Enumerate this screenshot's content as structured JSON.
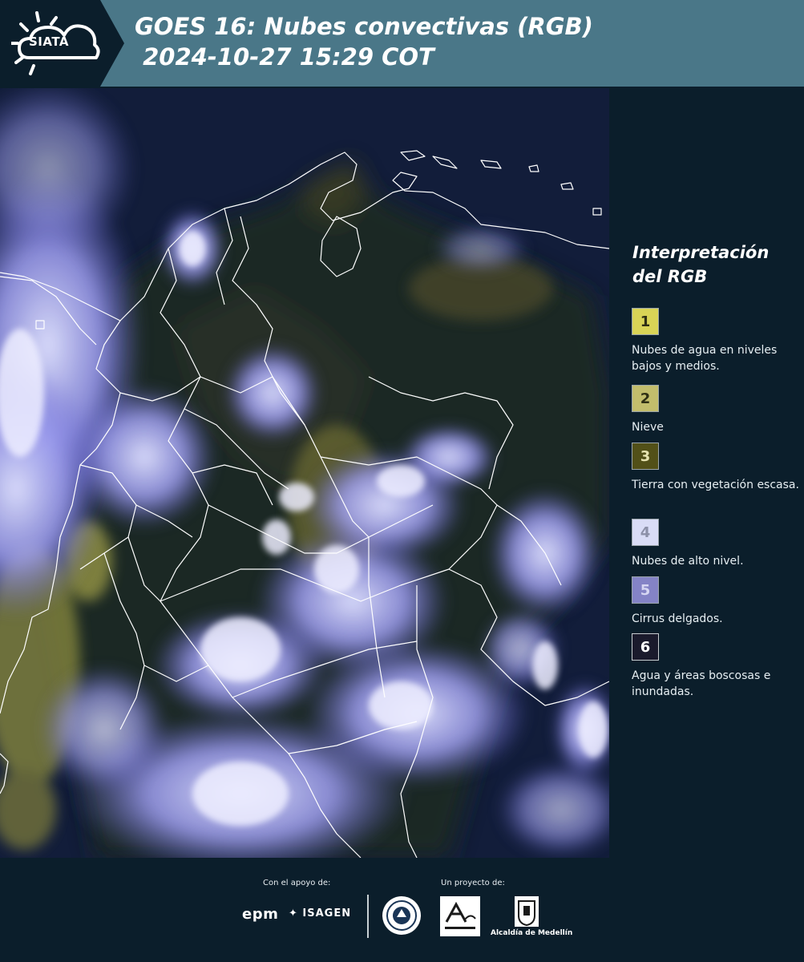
{
  "header": {
    "logo_text": "SIATA",
    "title_line1": "GOES 16: Nubes convectivas (RGB)",
    "title_line2": " 2024-10-27 15:29 COT"
  },
  "legend": {
    "title": "Interpretación del RGB",
    "items": [
      {
        "number": "1",
        "label": "Nubes de agua en niveles bajos y medios.",
        "color": "#d9d456"
      },
      {
        "number": "2",
        "label": "Nieve",
        "color": "#c2bd6c"
      },
      {
        "number": "3",
        "label": "Tierra con vegetación escasa.",
        "color": "#525018"
      },
      {
        "number": "4",
        "label": "Nubes de alto nivel.",
        "color": "#d9dcf6"
      },
      {
        "number": "5",
        "label": "Cirrus delgados.",
        "color": "#8483c6"
      },
      {
        "number": "6",
        "label": "Agua y áreas boscosas e inundadas.",
        "color": "#1a1a2c"
      }
    ]
  },
  "footer": {
    "support_label": "Con el apoyo de:",
    "project_label": "Un proyecto de:",
    "sponsors": [
      "epm",
      "ISAGEN"
    ],
    "partners": [
      "Área Metropolitana Valle de Aburrá",
      "Alcaldía de Medellín"
    ],
    "alcaldia_label": "Alcaldía de Medellín"
  }
}
